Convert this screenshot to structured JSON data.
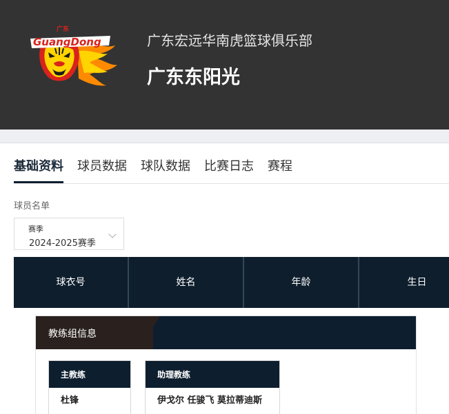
{
  "header": {
    "club_name": "广东宏远华南虎篮球俱乐部",
    "team_name": "广东东阳光",
    "logo": {
      "icon": "tiger-logo-icon",
      "text": "广东 GuangDong",
      "colors": {
        "red": "#d9231c",
        "yellow": "#ffd400",
        "orange": "#ff8a00"
      }
    }
  },
  "tabs": [
    {
      "label": "基础资料",
      "active": true
    },
    {
      "label": "球员数据",
      "active": false
    },
    {
      "label": "球队数据",
      "active": false
    },
    {
      "label": "比赛日志",
      "active": false
    },
    {
      "label": "赛程",
      "active": false
    }
  ],
  "roster": {
    "section_label": "球员名单",
    "season_select": {
      "label": "赛季",
      "value": "2024-2025赛季",
      "icon": "chevron-down-icon"
    },
    "columns": [
      "球衣号",
      "姓名",
      "年龄",
      "生日"
    ]
  },
  "coaches": {
    "title": "教练组信息",
    "cards": [
      {
        "role": "主教练",
        "names": "杜锋"
      },
      {
        "role": "助理教练",
        "names": "伊戈尔 任骏飞 莫拉蒂迪斯"
      }
    ]
  },
  "colors": {
    "header_bg": "#333333",
    "navy": "#0d1e2f",
    "dark_brown": "#2a211e"
  }
}
